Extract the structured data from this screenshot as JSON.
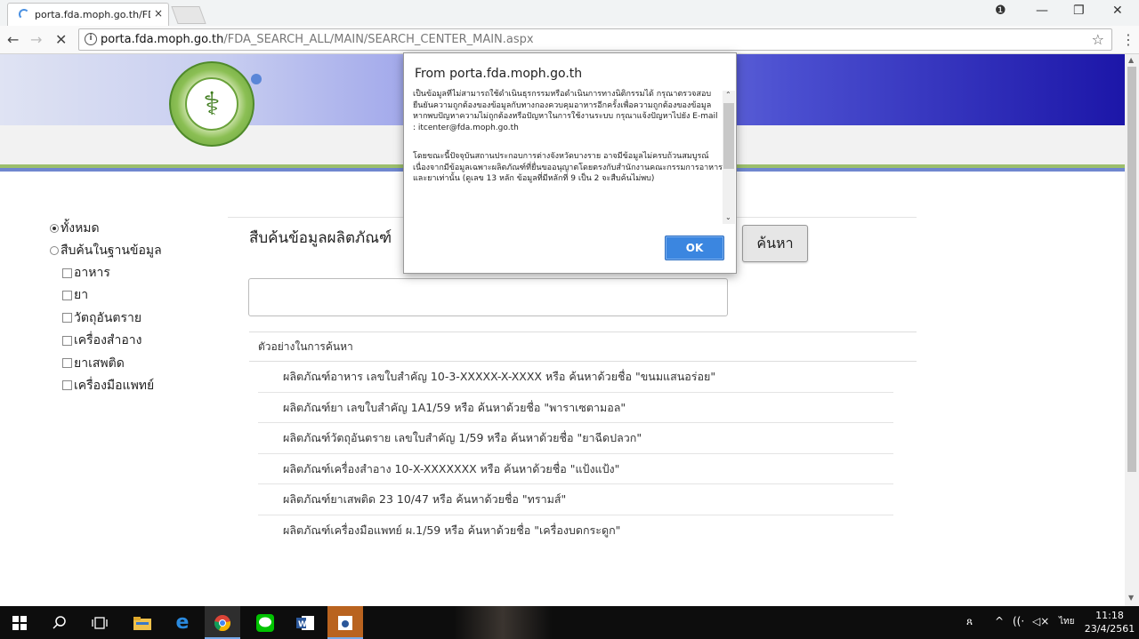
{
  "browser": {
    "tab_title": "porta.fda.moph.go.th/FD",
    "tab_close": "×",
    "url_host": "porta.fda.moph.go.th",
    "url_path": "/FDA_SEARCH_ALL/MAIN/SEARCH_CENTER_MAIN.aspx",
    "back_glyph": "←",
    "forward_glyph": "→",
    "stop_glyph": "✕",
    "info_glyph": "i",
    "star_glyph": "☆",
    "menu_glyph": "⋮",
    "account_glyph": "❶",
    "minimize_glyph": "—",
    "restore_glyph": "❐",
    "close_glyph": "✕"
  },
  "sidebar": {
    "scope_all": "ทั้งหมด",
    "scope_db": "สืบค้นในฐานข้อมูล",
    "categories": [
      "อาหาร",
      "ยา",
      "วัตถุอันตราย",
      "เครื่องสำอาง",
      "ยาเสพติด",
      "เครื่องมือแพทย์"
    ]
  },
  "search": {
    "title": "สืบค้นข้อมูลผลิตภัณฑ์",
    "button": "ค้นหา",
    "input_value": ""
  },
  "examples": {
    "header": "ตัวอย่างในการค้นหา",
    "rows": [
      "ผลิตภัณฑ์อาหาร เลขใบสำคัญ 10-3-XXXXX-X-XXXX หรือ ค้นหาด้วยชื่อ  \"ขนมแสนอร่อย\"",
      "ผลิตภัณฑ์ยา เลขใบสำคัญ 1A1/59 หรือ ค้นหาด้วยชื่อ \"พาราเซตามอล\"",
      "ผลิตภัณฑ์วัตถุอันตราย เลขใบสำคัญ 1/59 หรือ ค้นหาด้วยชื่อ \"ยาฉีดปลวก\"",
      "ผลิตภัณฑ์เครื่องสำอาง 10-X-XXXXXXX หรือ ค้นหาด้วยชื่อ \"แป้งแป้ง\"",
      "ผลิตภัณฑ์ยาเสพติด 23 10/47 หรือ ค้นหาด้วยชื่อ \"ทรามส์\"",
      "ผลิตภัณฑ์เครื่องมือแพทย์ ผ.1/59 หรือ ค้นหาด้วยชื่อ \"เครื่องบดกระดูก\""
    ]
  },
  "dialog": {
    "title": "From porta.fda.moph.go.th",
    "paragraph1": "เป็นข้อมูลที่ไม่สามารถใช้ดำเนินธุรกรรมหรือดำเนินการทางนิติกรรมได้ กรุณาตรวจสอบยืนยันความถูกต้องของข้อมูลกับทางกองควบคุมอาหารอีกครั้งเพื่อความถูกต้องของข้อมูล หากพบปัญหาความไม่ถูกต้องหรือปัญหาในการใช้งานระบบ กรุณาแจ้งปัญหาไปยัง E-mail : itcenter@fda.moph.go.th",
    "paragraph2": "โดยขณะนี้ปัจจุบันสถานประกอบการต่างจังหวัดบางราย อาจมีข้อมูลไม่ครบถ้วนสมบูรณ์ เนื่องจากมีข้อมูลเฉพาะผลิตภัณฑ์ที่ยื่นขออนุญาตโดยตรงกับสำนักงานคณะกรรมการอาหารและยาเท่านั้น (ดูเลข 13 หลัก ข้อมูลที่มีหลักที่ 9 เป็น 2 จะสืบค้นไม่พบ)",
    "ok": "OK"
  },
  "taskbar": {
    "tray_people": "ጸ",
    "tray_arrow": "^",
    "tray_wifi": "((·",
    "tray_volume": "◁×",
    "tray_lang": "ไทย",
    "time": "11:18",
    "date": "23/4/2561"
  },
  "colors": {
    "banner_dark": "#1c16a8",
    "stripe_green": "#9cbf6c",
    "stripe_blue": "#6f87cf",
    "ok_button": "#3b86e0",
    "logo_green": "#5f9b33"
  }
}
